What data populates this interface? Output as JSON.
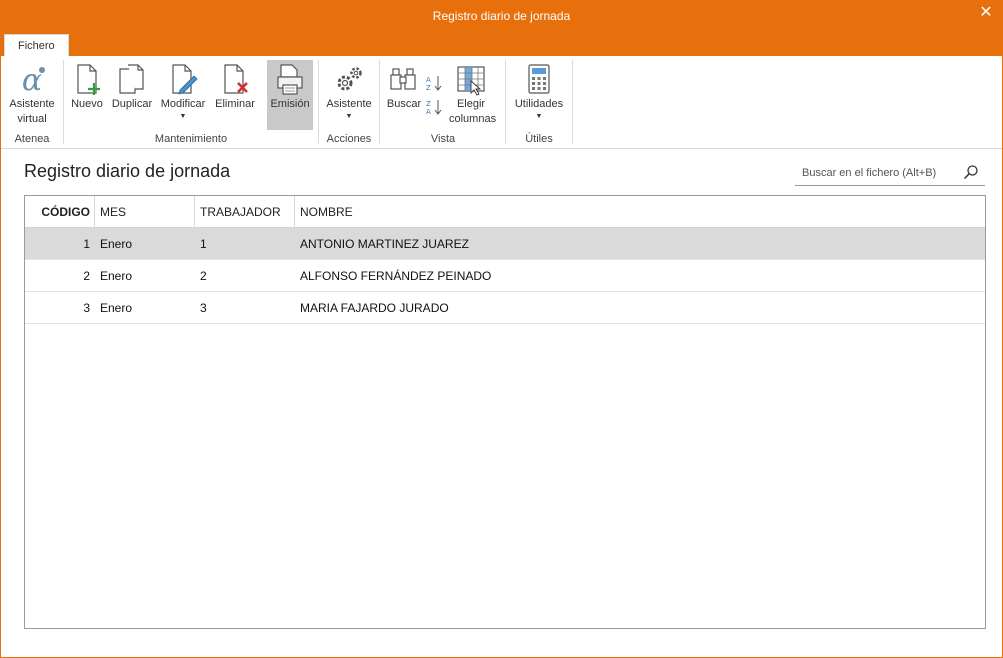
{
  "window": {
    "title": "Registro diario de jornada",
    "close_glyph": "✕",
    "accent_color": "#e8700c"
  },
  "tabs": [
    {
      "label": "Fichero",
      "active": true
    }
  ],
  "ribbon": {
    "groups": {
      "atenea": {
        "label": "Atenea",
        "asistente_virtual": {
          "line1": "Asistente",
          "line2": "virtual",
          "icon": "alpha-icon"
        }
      },
      "mantenimiento": {
        "label": "Mantenimiento",
        "nuevo": {
          "label": "Nuevo",
          "icon": "new-document-icon"
        },
        "duplicar": {
          "label": "Duplicar",
          "icon": "duplicate-icon"
        },
        "modificar": {
          "label": "Modificar",
          "icon": "edit-document-icon"
        },
        "eliminar": {
          "label": "Eliminar",
          "icon": "delete-document-icon"
        },
        "emision": {
          "label": "Emisión",
          "icon": "print-icon"
        }
      },
      "acciones": {
        "label": "Acciones",
        "asistente": {
          "label": "Asistente",
          "icon": "gears-icon"
        }
      },
      "vista": {
        "label": "Vista",
        "buscar": {
          "label": "Buscar",
          "icon": "binoculars-icon"
        },
        "sort_asc": {
          "icon": "sort-az-icon"
        },
        "sort_desc": {
          "icon": "sort-za-icon"
        },
        "elegir_columnas": {
          "line1": "Elegir",
          "line2": "columnas",
          "icon": "columns-icon"
        }
      },
      "utiles": {
        "label": "Útiles",
        "utilidades": {
          "label": "Utilidades",
          "icon": "calculator-icon"
        }
      }
    },
    "caret_glyph": "▼"
  },
  "main": {
    "title": "Registro diario de jornada",
    "search": {
      "placeholder": "Buscar en el fichero (Alt+B)",
      "value": ""
    }
  },
  "table": {
    "columns": [
      "CÓDIGO",
      "MES",
      "TRABAJADOR",
      "NOMBRE"
    ],
    "rows": [
      {
        "codigo": "1",
        "mes": "Enero",
        "trabajador": "1",
        "nombre": "ANTONIO MARTINEZ JUAREZ",
        "selected": true
      },
      {
        "codigo": "2",
        "mes": "Enero",
        "trabajador": "2",
        "nombre": "ALFONSO FERNÁNDEZ PEINADO",
        "selected": false
      },
      {
        "codigo": "3",
        "mes": "Enero",
        "trabajador": "3",
        "nombre": "MARIA FAJARDO JURADO",
        "selected": false
      }
    ]
  }
}
